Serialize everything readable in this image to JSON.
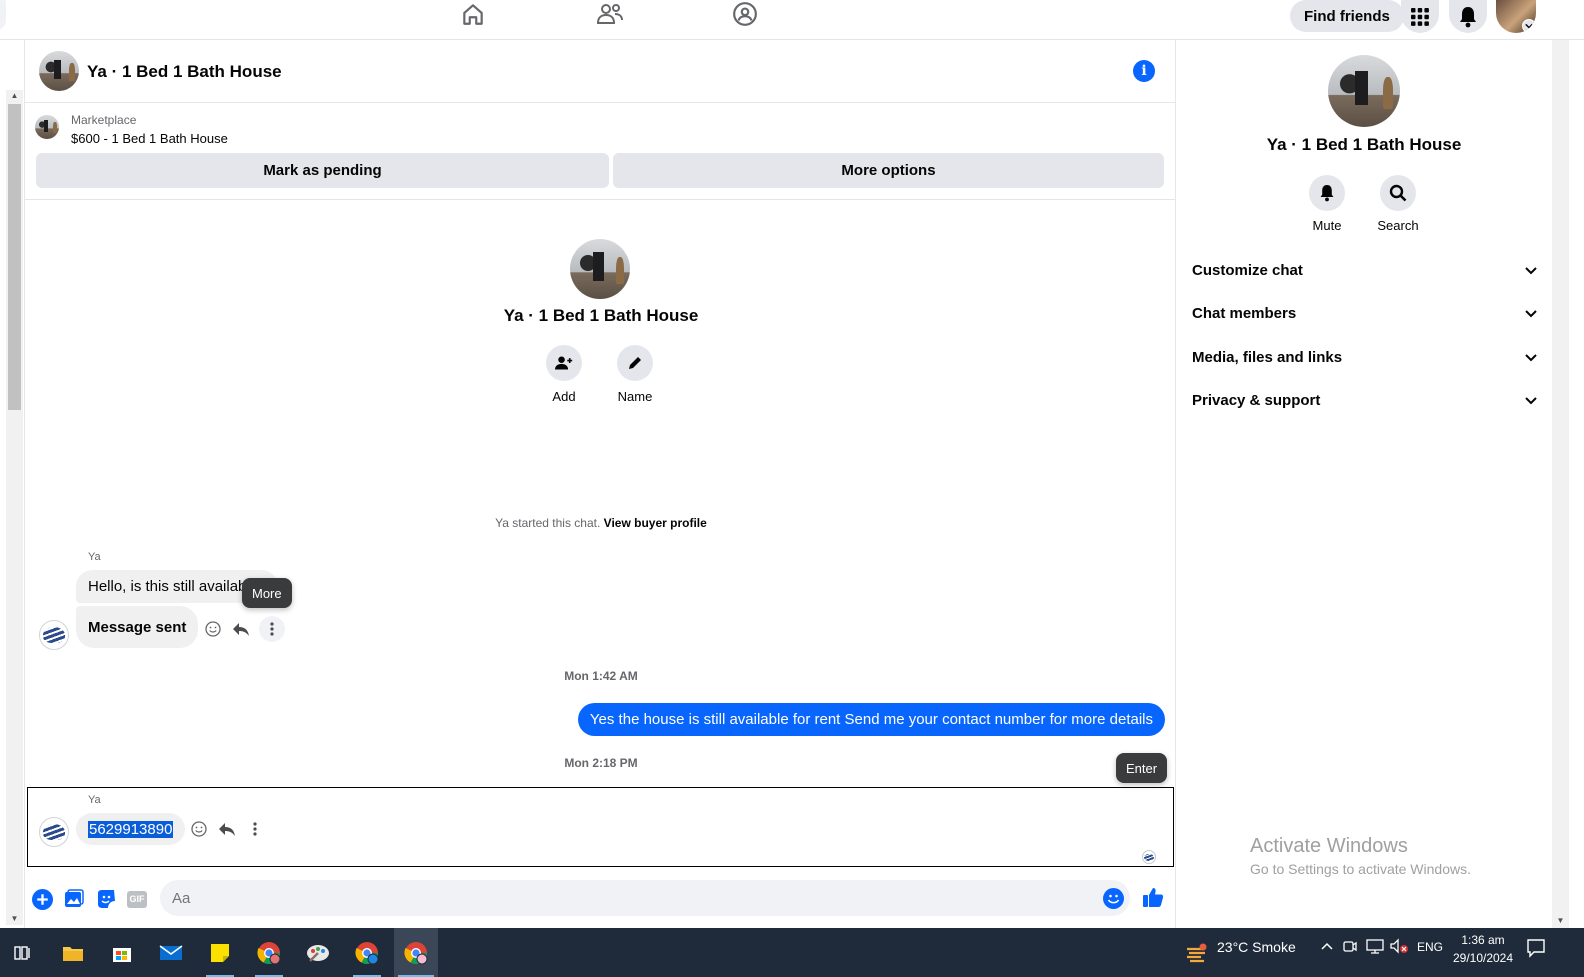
{
  "topnav": {
    "find_friends_label": "Find friends"
  },
  "chat": {
    "header_title": "Ya · 1 Bed 1 Bath House",
    "marketplace_label": "Marketplace",
    "listing_price_title": "$600 - 1 Bed 1 Bath House",
    "mark_pending_label": "Mark as pending",
    "more_options_label": "More options",
    "intro_title": "Ya · 1 Bed 1 Bath House",
    "intro_actions": [
      {
        "label": "Add",
        "icon": "add-person-icon"
      },
      {
        "label": "Name",
        "icon": "pencil-icon"
      }
    ],
    "started_text": "Ya started this chat.",
    "view_buyer_profile": "View buyer profile",
    "messages": [
      {
        "sender": "Ya",
        "text": "Hello, is this still available?",
        "direction": "in"
      },
      {
        "text": "Message sent",
        "direction": "in"
      },
      {
        "timestamp": "Mon 1:42 AM"
      },
      {
        "text": "Yes the house is still available for rent Send me your contact number for more details",
        "direction": "out"
      },
      {
        "timestamp": "Mon 2:18 PM"
      },
      {
        "sender": "Ya",
        "text": "5629913890",
        "direction": "in",
        "selected": true
      }
    ],
    "tooltip_more": "More",
    "tooltip_enter": "Enter",
    "composer_placeholder": "Aa",
    "gif_label": "GIF"
  },
  "details_panel": {
    "title": "Ya · 1 Bed 1 Bath House",
    "actions": [
      {
        "label": "Mute",
        "icon": "bell-icon"
      },
      {
        "label": "Search",
        "icon": "search-icon"
      }
    ],
    "sections": [
      "Customize chat",
      "Chat members",
      "Media, files and links",
      "Privacy & support"
    ]
  },
  "watermark": {
    "line1": "Activate Windows",
    "line2": "Go to Settings to activate Windows."
  },
  "taskbar": {
    "weather": "23°C  Smoke",
    "language": "ENG",
    "time": "1:36 am",
    "date": "29/10/2024"
  },
  "colors": {
    "messenger_blue": "#0866ff",
    "bubble_gray": "#f0f0f0",
    "button_gray": "#e4e6eb",
    "taskbar": "#1f2b3a"
  }
}
